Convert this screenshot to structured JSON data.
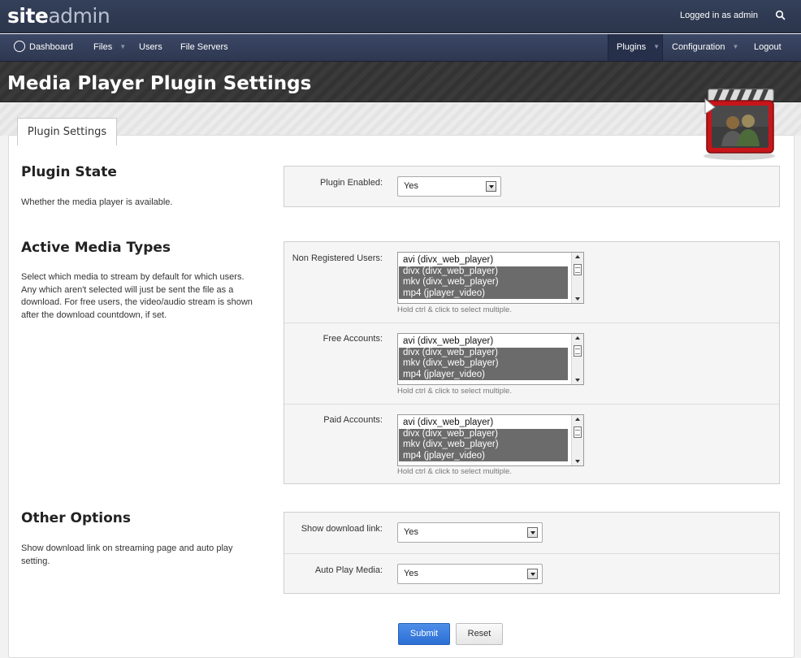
{
  "app": {
    "logo_bold": "site",
    "logo_light": "admin"
  },
  "topbar": {
    "logged_in_text": "Logged in as admin",
    "search_icon": "search-icon"
  },
  "nav": {
    "dashboard": "Dashboard",
    "files": "Files",
    "users": "Users",
    "file_servers": "File Servers",
    "plugins": "Plugins",
    "configuration": "Configuration",
    "logout": "Logout"
  },
  "page": {
    "title": "Media Player Plugin Settings",
    "tab_label": "Plugin Settings"
  },
  "sections": {
    "plugin_state": {
      "title": "Plugin State",
      "description": "Whether the media player is available.",
      "plugin_enabled_label": "Plugin Enabled:",
      "plugin_enabled_value": "Yes"
    },
    "media_types": {
      "title": "Active Media Types",
      "description": "Select which media to stream by default for which users. Any which aren't selected will just be sent the file as a download. For free users, the video/audio stream is shown after the download countdown, if set.",
      "hint": "Hold ctrl & click to select multiple.",
      "non_registered_label": "Non Registered Users:",
      "free_label": "Free Accounts:",
      "paid_label": "Paid Accounts:",
      "options": [
        {
          "text": "avi (divx_web_player)",
          "selected": false
        },
        {
          "text": "divx (divx_web_player)",
          "selected": true
        },
        {
          "text": "mkv (divx_web_player)",
          "selected": true
        },
        {
          "text": "mp4 (jplayer_video)",
          "selected": true
        }
      ]
    },
    "other_options": {
      "title": "Other Options",
      "description": "Show download link on streaming page and auto play setting.",
      "show_download_label": "Show download link:",
      "show_download_value": "Yes",
      "auto_play_label": "Auto Play Media:",
      "auto_play_value": "Yes"
    }
  },
  "buttons": {
    "submit": "Submit",
    "reset": "Reset"
  },
  "colors": {
    "submit_blue": "#2b6fd4",
    "nav_bg": "#2e3850",
    "selected_option": "#6b6b6b",
    "plugin_icon_red": "#c8151a"
  }
}
